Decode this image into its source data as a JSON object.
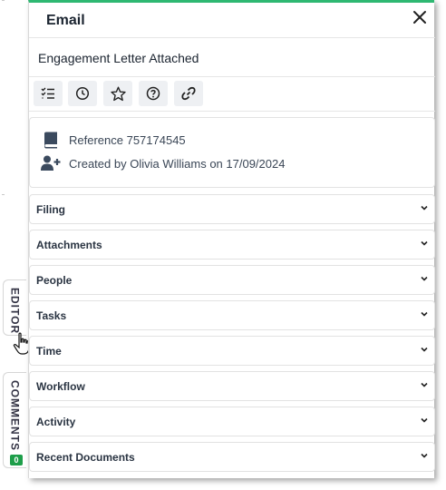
{
  "panel": {
    "title": "Email",
    "subject": "Engagement Letter Attached",
    "accent_color": "#2eb872"
  },
  "toolbar": {
    "buttons": [
      {
        "icon": "checklist-icon"
      },
      {
        "icon": "clock-icon"
      },
      {
        "icon": "star-icon"
      },
      {
        "icon": "question-icon"
      },
      {
        "icon": "link-icon"
      }
    ]
  },
  "info": {
    "reference": "Reference 757174545",
    "created": "Created by Olivia Williams on 17/09/2024"
  },
  "sections": [
    {
      "label": "Filing"
    },
    {
      "label": "Attachments"
    },
    {
      "label": "People"
    },
    {
      "label": "Tasks"
    },
    {
      "label": "Time"
    },
    {
      "label": "Workflow"
    },
    {
      "label": "Activity"
    },
    {
      "label": "Recent Documents"
    }
  ],
  "side_tabs": {
    "editor": "EDITOR",
    "comments": "COMMENTS",
    "comments_count": "0"
  }
}
